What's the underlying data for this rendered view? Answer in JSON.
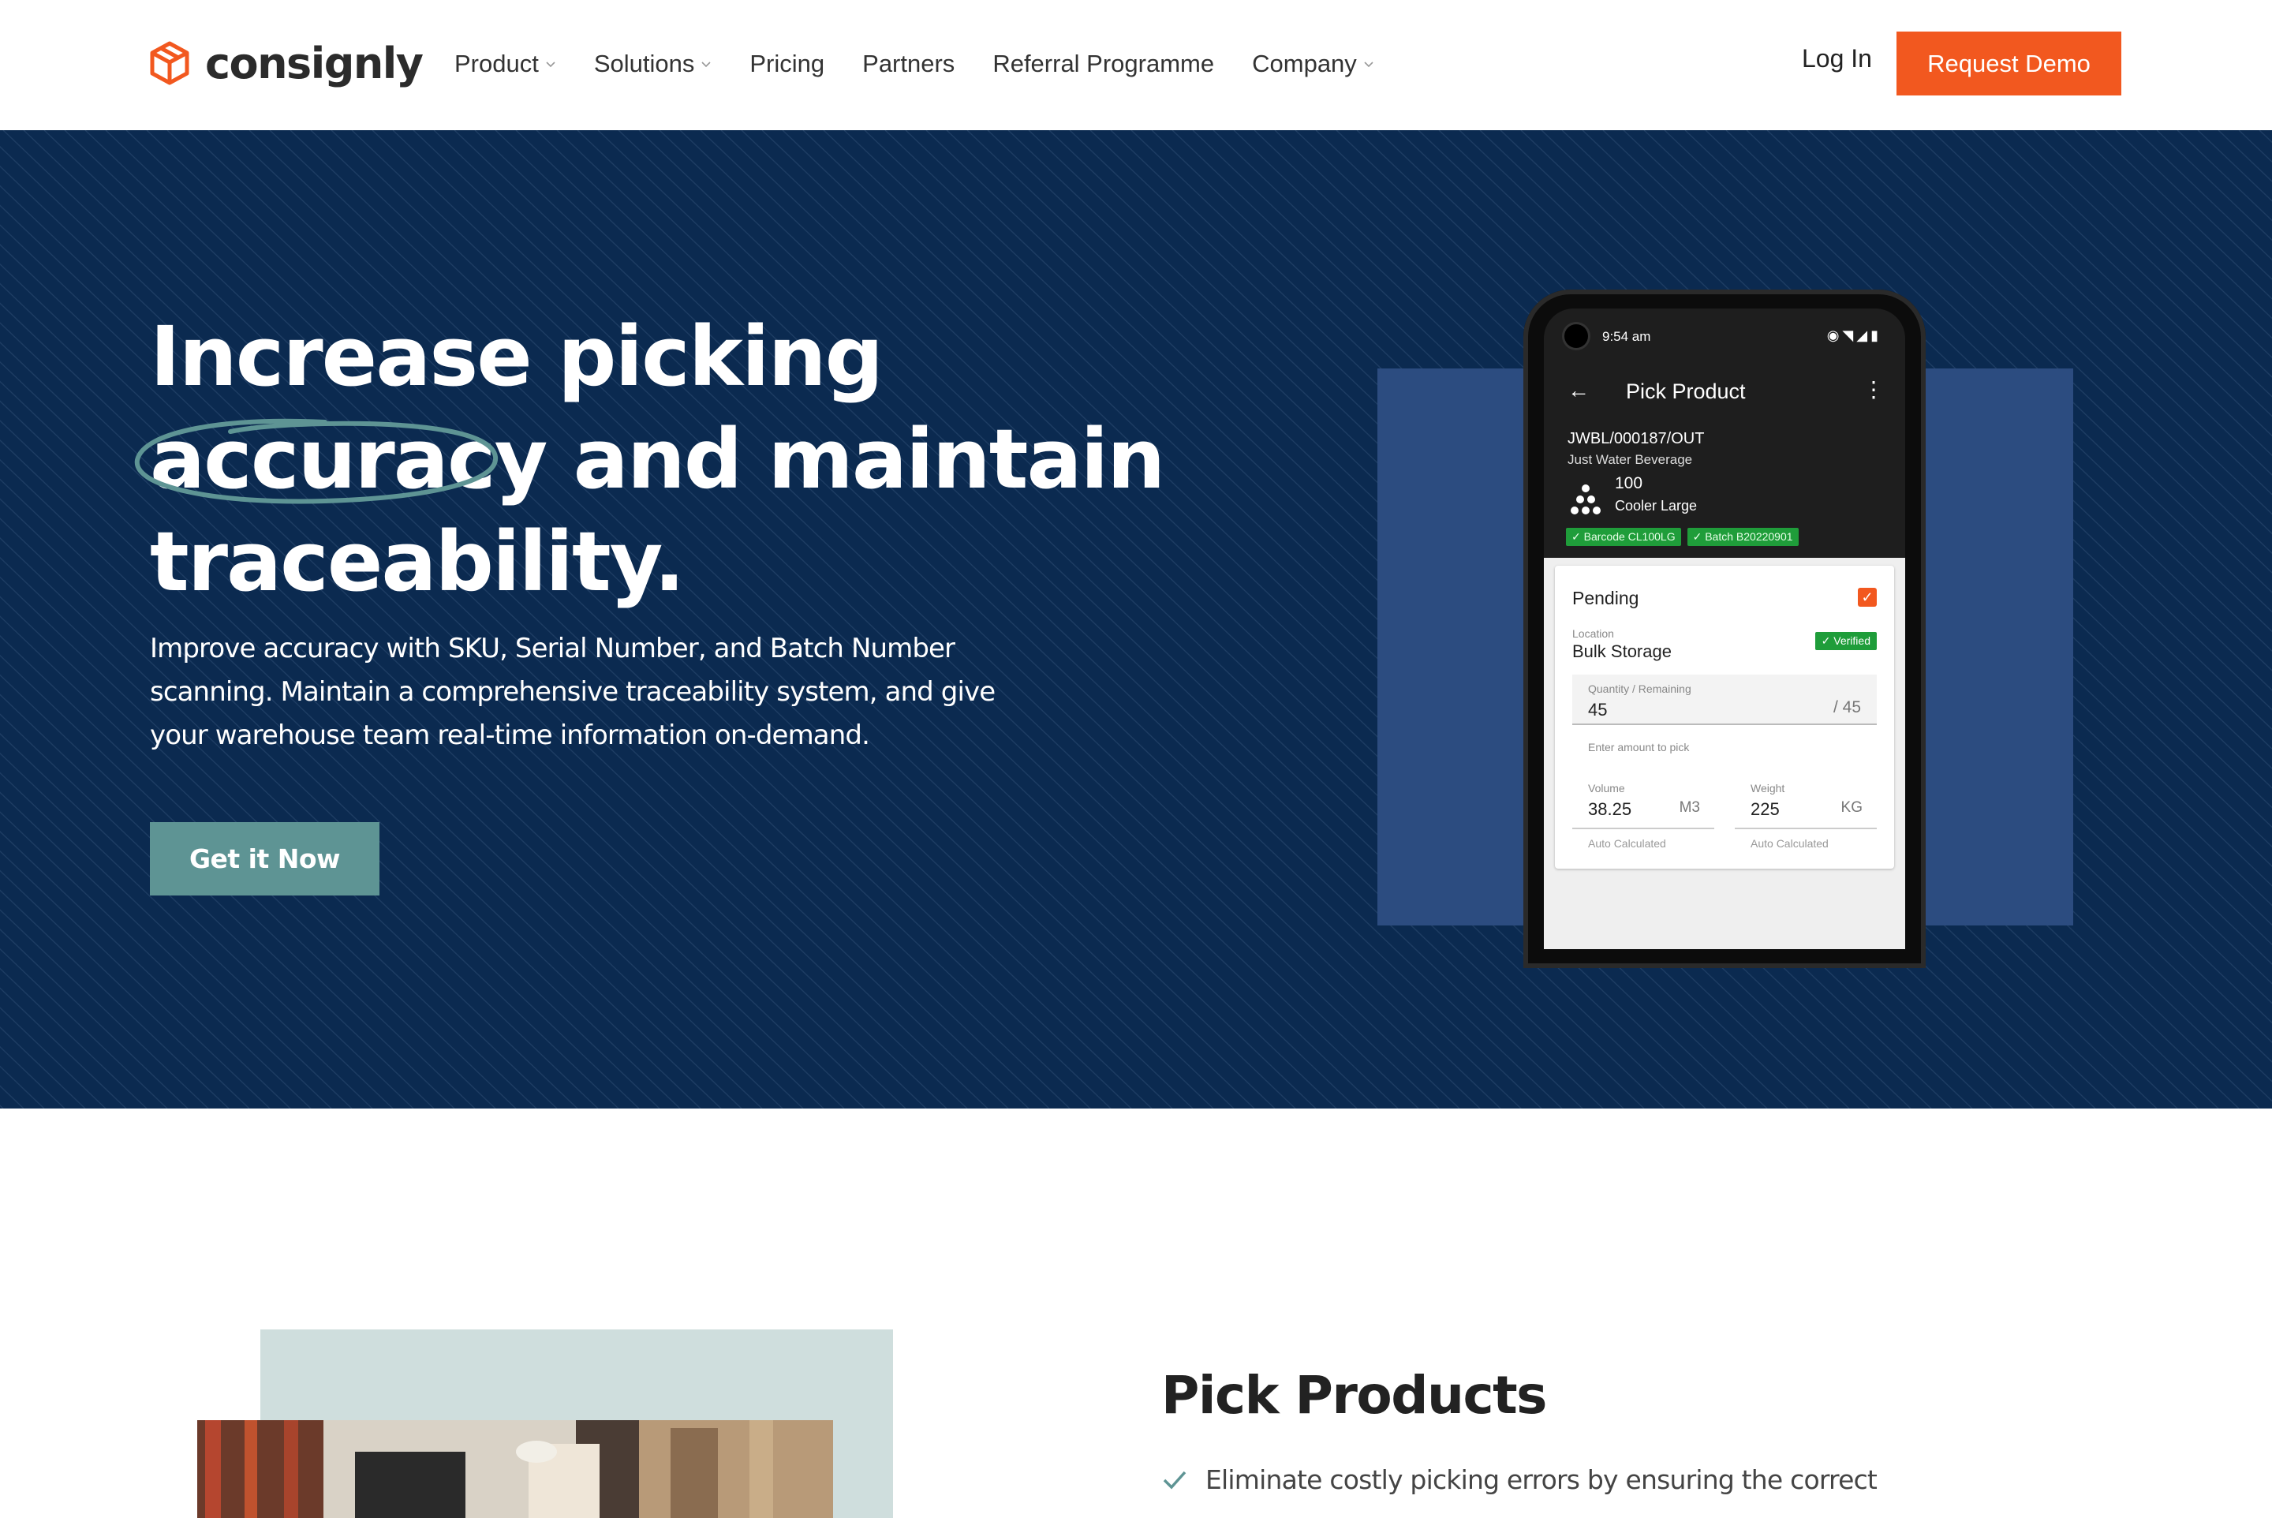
{
  "brand": {
    "name": "consignly",
    "accent": "#f2581f"
  },
  "nav": {
    "items": [
      {
        "label": "Product",
        "dropdown": true
      },
      {
        "label": "Solutions",
        "dropdown": true
      },
      {
        "label": "Pricing",
        "dropdown": false
      },
      {
        "label": "Partners",
        "dropdown": false
      },
      {
        "label": "Referral Programme",
        "dropdown": false
      },
      {
        "label": "Company",
        "dropdown": true
      }
    ],
    "login": "Log In",
    "demo": "Request Demo"
  },
  "hero": {
    "headline_line1": "Increase picking",
    "headline_circled": "accuracy",
    "headline_line2_rest": " and maintain",
    "headline_line3": "traceability.",
    "subtext": "Improve accuracy with SKU, Serial Number, and Batch Number scanning.  Maintain a comprehensive traceability system, and give your warehouse team real-time information on-demand.",
    "cta": "Get it Now",
    "background": "#0b2a50"
  },
  "phone": {
    "time": "9:54 am",
    "screen_title": "Pick Product",
    "order_number": "JWBL/000187/OUT",
    "customer": "Just Water Beverage",
    "quantity": "100",
    "item_name": "Cooler Large",
    "tags": [
      "Barcode CL100LG",
      "Batch B20220901"
    ],
    "card": {
      "status": "Pending",
      "location_label": "Location",
      "location": "Bulk Storage",
      "verified": "Verified",
      "qty_label": "Quantity / Remaining",
      "qty_value": "45",
      "qty_remaining": "/ 45",
      "pick_hint": "Enter amount to pick",
      "volume_label": "Volume",
      "volume_value": "38.25",
      "volume_unit": "M3",
      "weight_label": "Weight",
      "weight_value": "225",
      "weight_unit": "KG",
      "auto_calc": "Auto Calculated"
    }
  },
  "feature": {
    "title": "Pick Products",
    "bullet1": "Eliminate costly picking errors by ensuring the correct"
  }
}
